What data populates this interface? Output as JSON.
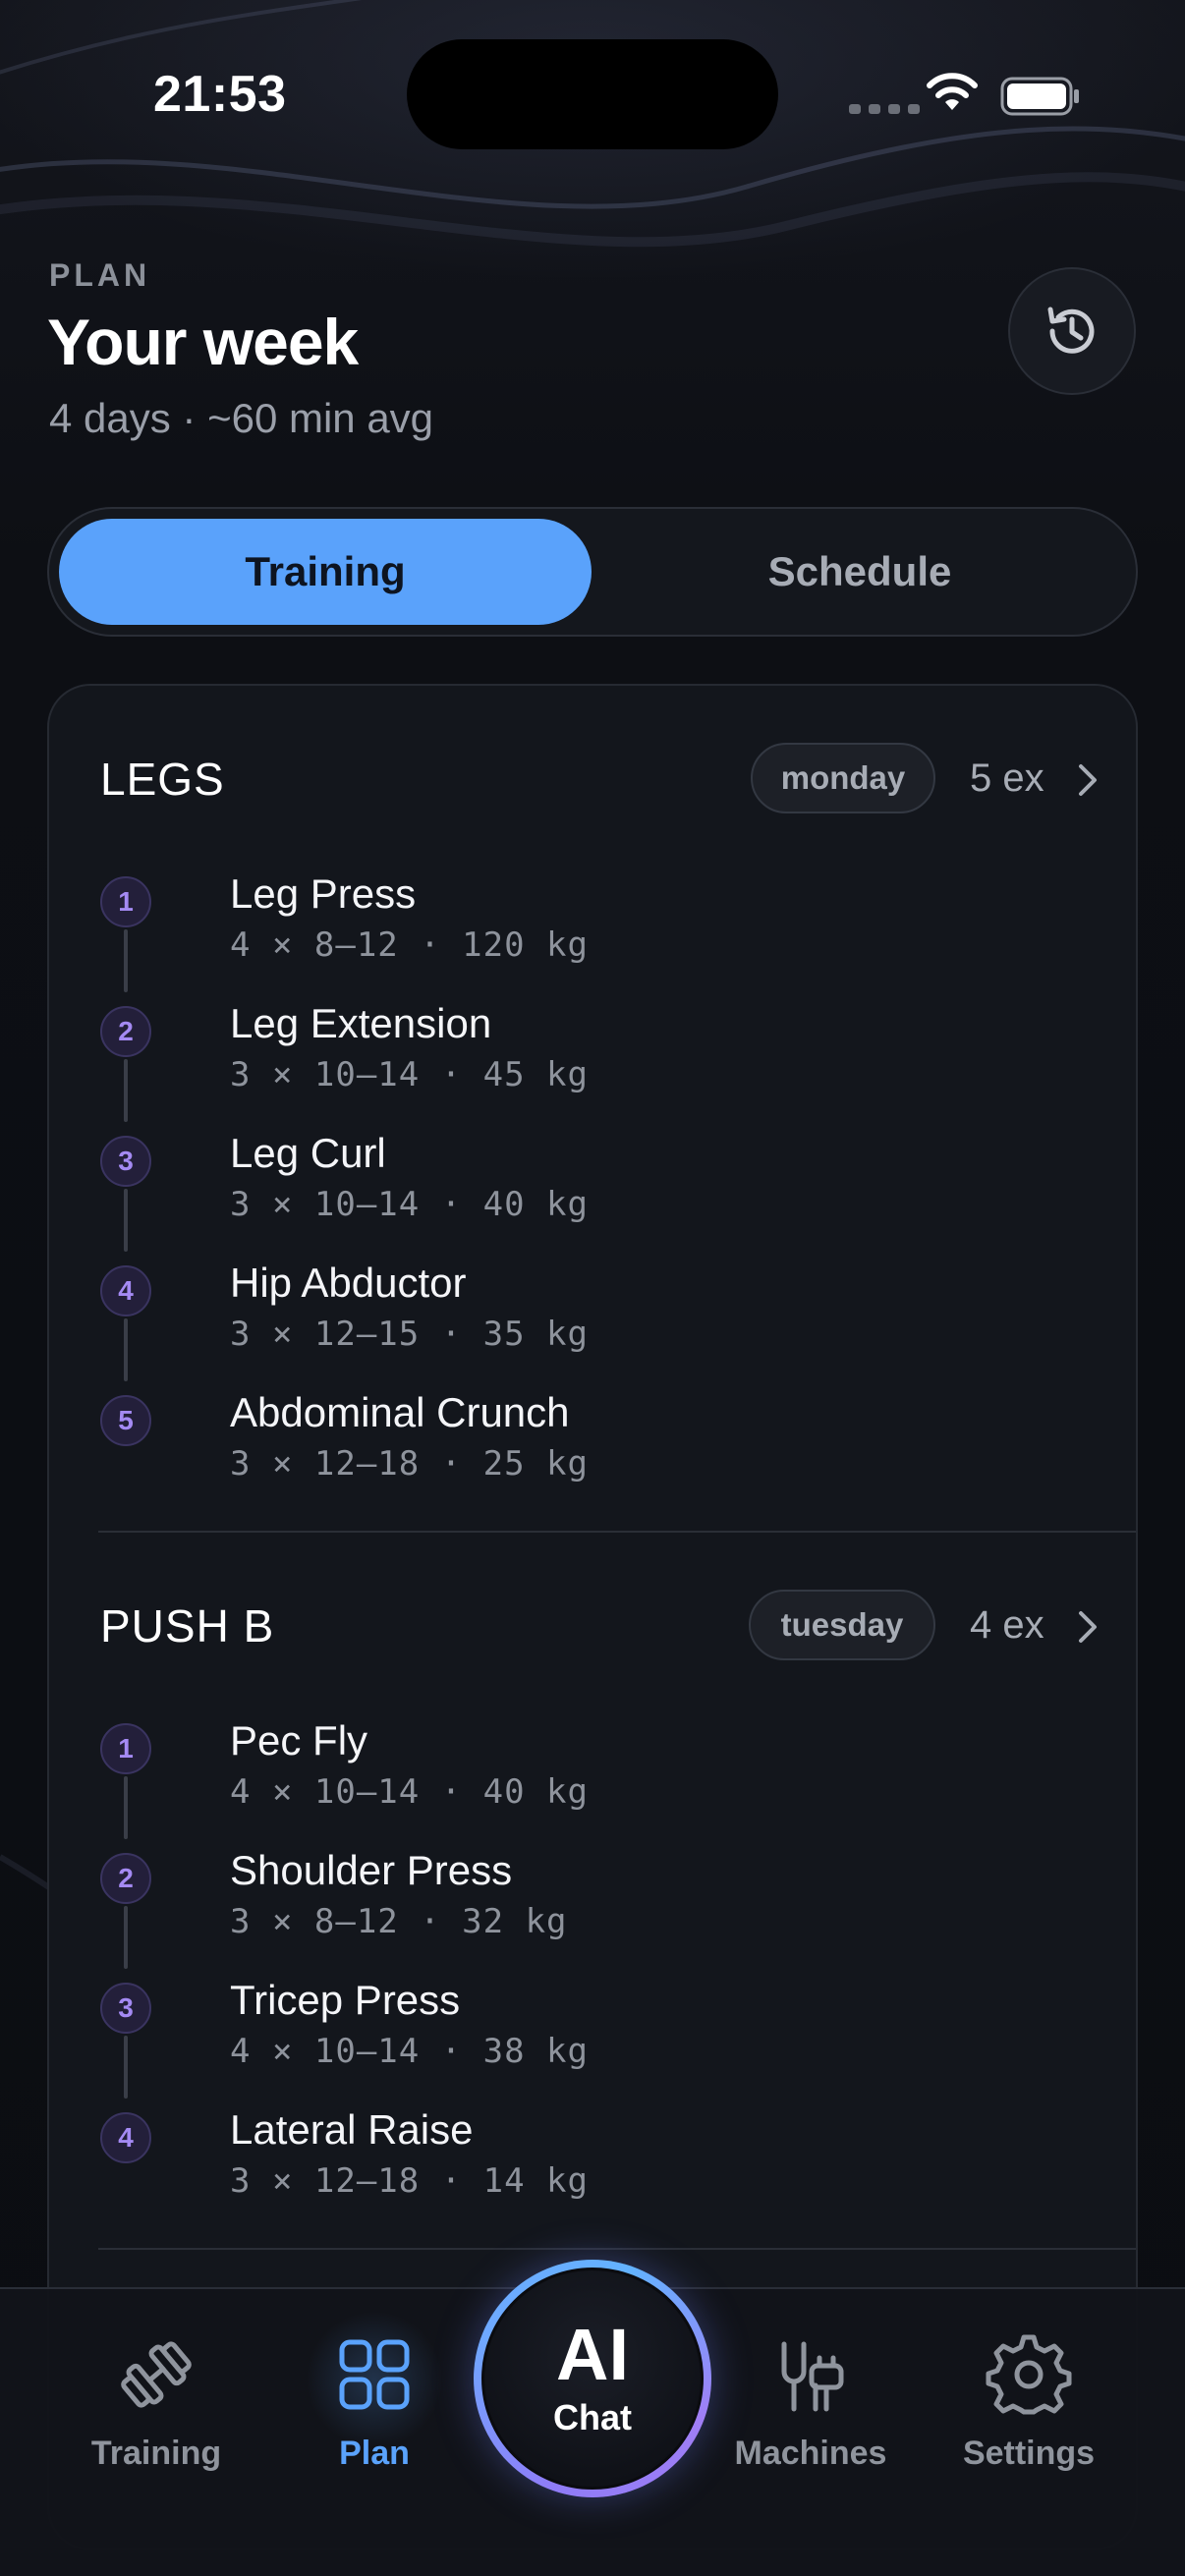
{
  "status_bar": {
    "time": "21:53"
  },
  "header": {
    "eyebrow": "PLAN",
    "title": "Your week",
    "subtitle": "4 days · ~60 min avg"
  },
  "segmented": {
    "options": [
      "Training",
      "Schedule"
    ],
    "selected": "Training"
  },
  "workouts": [
    {
      "title": "LEGS",
      "day": "monday",
      "count_label": "5 ex",
      "exercises": [
        {
          "num": "1",
          "name": "Leg Press",
          "detail": "4 × 8–12 · 120 kg"
        },
        {
          "num": "2",
          "name": "Leg Extension",
          "detail": "3 × 10–14 · 45 kg"
        },
        {
          "num": "3",
          "name": "Leg Curl",
          "detail": "3 × 10–14 · 40 kg"
        },
        {
          "num": "4",
          "name": "Hip Abductor",
          "detail": "3 × 12–15 · 35 kg"
        },
        {
          "num": "5",
          "name": "Abdominal Crunch",
          "detail": "3 × 12–18 · 25 kg"
        }
      ]
    },
    {
      "title": "PUSH B",
      "day": "tuesday",
      "count_label": "4 ex",
      "exercises": [
        {
          "num": "1",
          "name": "Pec Fly",
          "detail": "4 × 10–14 · 40 kg"
        },
        {
          "num": "2",
          "name": "Shoulder Press",
          "detail": "3 × 8–12 · 32 kg"
        },
        {
          "num": "3",
          "name": "Tricep Press",
          "detail": "4 × 10–14 · 38 kg"
        },
        {
          "num": "4",
          "name": "Lateral Raise",
          "detail": "3 × 12–18 · 14 kg"
        }
      ]
    }
  ],
  "tabbar": {
    "training": "Training",
    "plan": "Plan",
    "ai_big": "AI",
    "ai_small": "Chat",
    "machines": "Machines",
    "settings": "Settings",
    "active": "Plan"
  },
  "colors": {
    "accent": "#5aa2fb",
    "number_badge": "#a48af3",
    "background": "#0c0e13",
    "card": "#13161c"
  },
  "icons": {
    "history": "history-clock-icon",
    "training": "dumbbell-icon",
    "plan": "grid-icon",
    "machines": "plug-icon",
    "settings": "gear-icon",
    "chevron": "chevron-right-icon"
  }
}
